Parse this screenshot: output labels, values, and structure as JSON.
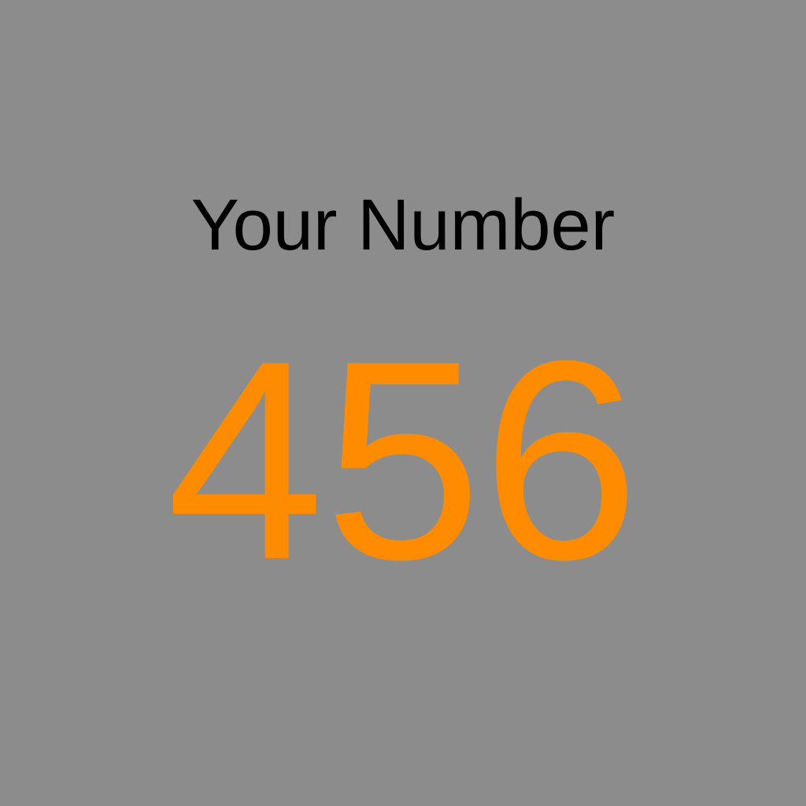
{
  "screen": {
    "background_color": "#8c8c8c",
    "title": "Your Number",
    "title_color": "#000000",
    "number": "456",
    "number_color": "#ff8c00"
  }
}
